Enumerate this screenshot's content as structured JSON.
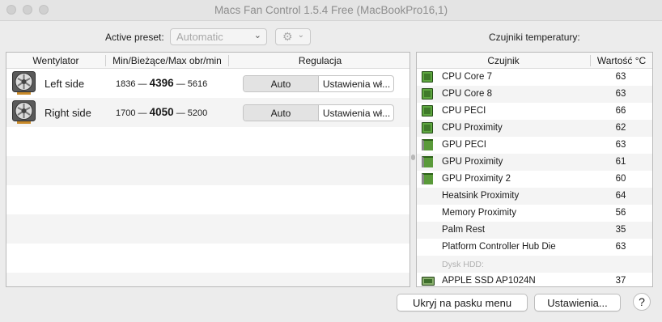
{
  "window": {
    "title": "Macs Fan Control 1.5.4 Free (MacBookPro16,1)"
  },
  "toolbar": {
    "preset_label": "Active preset:",
    "preset_value": "Automatic",
    "sensors_label": "Czujniki temperatury:"
  },
  "fans": {
    "headers": {
      "fan": "Wentylator",
      "rpm": "Min/Bieżące/Max obr/min",
      "control": "Regulacja"
    },
    "rows": [
      {
        "name": "Left side",
        "min": "1836",
        "current": "4396",
        "max": "5616",
        "dash": "—",
        "auto": "Auto",
        "custom": "Ustawienia wł..."
      },
      {
        "name": "Right side",
        "min": "1700",
        "current": "4050",
        "max": "5200",
        "dash": "—",
        "auto": "Auto",
        "custom": "Ustawienia wł..."
      }
    ]
  },
  "sensors": {
    "headers": {
      "sensor": "Czujnik",
      "value": "Wartość °C"
    },
    "rows": [
      {
        "name": "CPU Core 7",
        "value": "63",
        "icon": "cpu-chip-icon"
      },
      {
        "name": "CPU Core 8",
        "value": "63",
        "icon": "cpu-chip-icon"
      },
      {
        "name": "CPU PECI",
        "value": "66",
        "icon": "cpu-chip-icon"
      },
      {
        "name": "CPU Proximity",
        "value": "62",
        "icon": "cpu-chip-icon"
      },
      {
        "name": "GPU PECI",
        "value": "63",
        "icon": "gpu-card-icon"
      },
      {
        "name": "GPU Proximity",
        "value": "61",
        "icon": "gpu-card-icon"
      },
      {
        "name": "GPU Proximity 2",
        "value": "60",
        "icon": "gpu-card-icon"
      },
      {
        "name": "Heatsink Proximity",
        "value": "64",
        "icon": ""
      },
      {
        "name": "Memory Proximity",
        "value": "56",
        "icon": ""
      },
      {
        "name": "Palm Rest",
        "value": "35",
        "icon": ""
      },
      {
        "name": "Platform Controller Hub Die",
        "value": "63",
        "icon": ""
      },
      {
        "name": "Dysk HDD:",
        "value": "",
        "icon": "",
        "group": true
      },
      {
        "name": "APPLE SSD AP1024N",
        "value": "37",
        "icon": "ssd-icon"
      }
    ]
  },
  "footer": {
    "hide_label": "Ukryj na pasku menu",
    "settings_label": "Ustawienia...",
    "help_label": "?"
  },
  "colors": {
    "window_bg": "#ececec",
    "chip_green": "#3f7a2a",
    "title_gray": "#8e8e8e"
  }
}
